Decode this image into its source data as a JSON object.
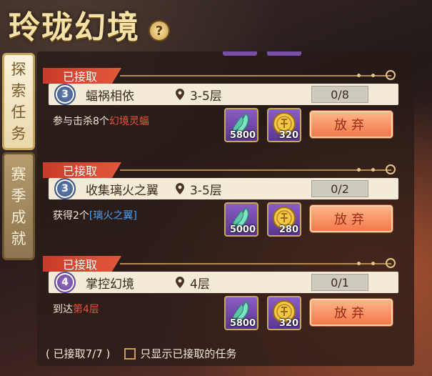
{
  "header": {
    "title": "玲珑幻境",
    "help_label": "?"
  },
  "tabs": [
    {
      "label_chars": [
        "探",
        "索",
        "任",
        "务"
      ],
      "active": true
    },
    {
      "label_chars": [
        "赛",
        "季",
        "成",
        "就"
      ],
      "active": false
    }
  ],
  "tasks": [
    {
      "status": "已接取",
      "level": "3",
      "level_color": "blue",
      "name": "蝠祸相依",
      "floor": "3-5层",
      "progress": "0/8",
      "desc_prefix": "参与击杀8个",
      "desc_highlight": "幻境灵蝠",
      "highlight_color": "red",
      "rewards": [
        {
          "icon": "feather-icon",
          "value": "5800"
        },
        {
          "icon": "gold-coin-icon",
          "value": "320"
        }
      ],
      "button": "放弃"
    },
    {
      "status": "已接取",
      "level": "3",
      "level_color": "blue",
      "name": "收集璃火之翼",
      "floor": "3-5层",
      "progress": "0/2",
      "desc_prefix": "获得2个",
      "desc_highlight": "[璃火之翼]",
      "highlight_color": "blue",
      "rewards": [
        {
          "icon": "feather-icon",
          "value": "5000"
        },
        {
          "icon": "gold-coin-icon",
          "value": "280"
        }
      ],
      "button": "放弃"
    },
    {
      "status": "已接取",
      "level": "4",
      "level_color": "purple",
      "name": "掌控幻境",
      "floor": "4层",
      "progress": "0/1",
      "desc_prefix": "到达",
      "desc_highlight": "第4层",
      "highlight_color": "red",
      "rewards": [
        {
          "icon": "feather-icon",
          "value": "5800"
        },
        {
          "icon": "gold-coin-icon",
          "value": "320"
        }
      ],
      "button": "放弃"
    }
  ],
  "footer": {
    "accepted_count": "( 已接取7/7 )",
    "filter_label": "只显示已接取的任务",
    "filter_checked": false
  }
}
